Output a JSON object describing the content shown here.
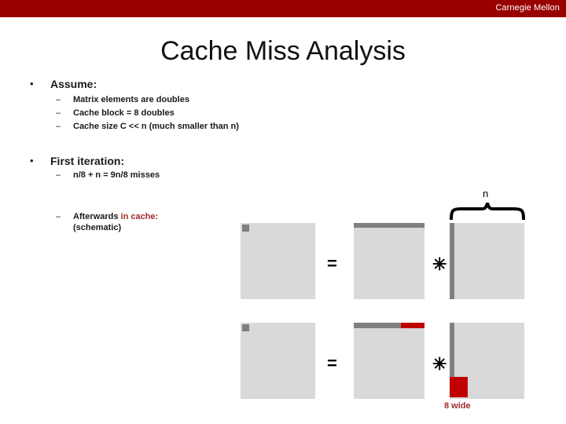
{
  "header": {
    "brand": "Carnegie Mellon",
    "brand_bar_color": "#990000"
  },
  "slide": {
    "title": "Cache Miss Analysis"
  },
  "body": {
    "bullets": [
      {
        "marker": "•",
        "label": "Assume:",
        "sub_marker": "–",
        "subs": [
          "Matrix elements are doubles",
          "Cache block = 8 doubles",
          "Cache size C << n (much smaller than n)"
        ]
      },
      {
        "marker": "•",
        "label": "First iteration:",
        "sub_marker": "–",
        "subs": [
          "n/8 + n = 9n/8 misses"
        ]
      }
    ],
    "afterwards": {
      "marker": "–",
      "text_plain": "Afterwards ",
      "text_accent": "in cache:",
      "text_line2": "(schematic)"
    }
  },
  "diagram": {
    "equals_symbol": "=",
    "times_symbol": "✳",
    "brace_label": "n",
    "width_label": "8 wide",
    "colors": {
      "matrix_fill": "#d9d9d9",
      "band_gray": "#808080",
      "band_red": "#c00000",
      "accent_red": "#9e2a2a"
    },
    "rows": [
      {
        "name": "first-iteration-row",
        "left_matrix": {
          "corner_block": "gray"
        },
        "middle_matrix": {
          "top_band": "gray-full"
        },
        "right_matrix": {
          "left_band": "gray-full"
        }
      },
      {
        "name": "afterwards-row",
        "left_matrix": {
          "corner_block": "gray"
        },
        "middle_matrix": {
          "top_band": "gray-then-red"
        },
        "right_matrix": {
          "left_band": "gray-partial",
          "block": "red"
        }
      }
    ]
  }
}
